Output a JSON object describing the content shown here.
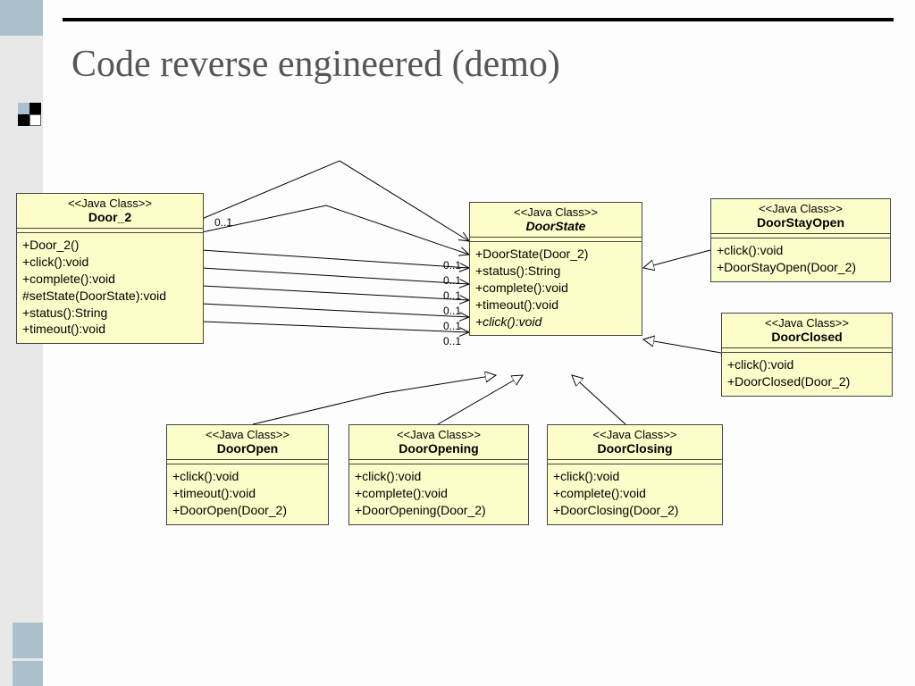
{
  "title": "Code reverse engineered (demo)",
  "stereotype": "<<Java Class>>",
  "multiplicity": "0..1",
  "classes": {
    "door2": {
      "name": "Door_2",
      "ops": [
        "+Door_2()",
        "+click():void",
        "+complete():void",
        "#setState(DoorState):void",
        "+status():String",
        "+timeout():void"
      ]
    },
    "doorState": {
      "name": "DoorState",
      "nameItalic": true,
      "ops": [
        "+DoorState(Door_2)",
        "+status():String",
        "+complete():void",
        "+timeout():void"
      ],
      "opsItalic": [
        "+click():void"
      ]
    },
    "doorStayOpen": {
      "name": "DoorStayOpen",
      "ops": [
        "+click():void",
        "+DoorStayOpen(Door_2)"
      ]
    },
    "doorClosed": {
      "name": "DoorClosed",
      "ops": [
        "+click():void",
        "+DoorClosed(Door_2)"
      ]
    },
    "doorOpen": {
      "name": "DoorOpen",
      "ops": [
        "+click():void",
        "+timeout():void",
        "+DoorOpen(Door_2)"
      ]
    },
    "doorOpening": {
      "name": "DoorOpening",
      "ops": [
        "+click():void",
        "+complete():void",
        "+DoorOpening(Door_2)"
      ]
    },
    "doorClosing": {
      "name": "DoorClosing",
      "ops": [
        "+click():void",
        "+complete():void",
        "+DoorClosing(Door_2)"
      ]
    }
  }
}
